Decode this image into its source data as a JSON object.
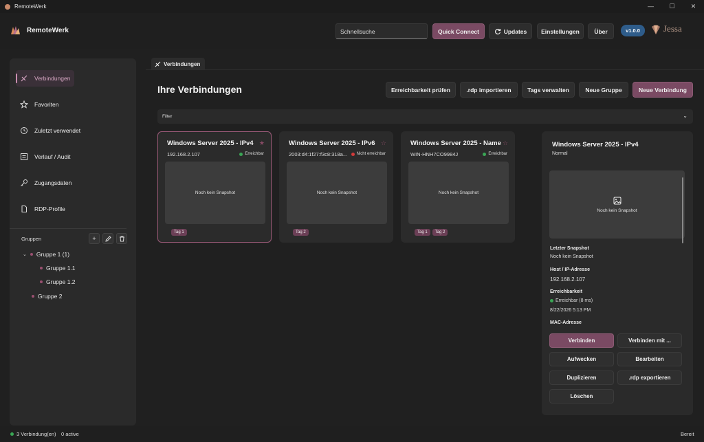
{
  "window": {
    "title": "RemoteWerk",
    "min": "—",
    "max": "☐",
    "close": "✕"
  },
  "header": {
    "app_name": "RemoteWerk",
    "search_value": "Schnellsuche",
    "quick_connect": "Quick Connect",
    "updates": "Updates",
    "settings": "Einstellungen",
    "about": "Über",
    "version": "v1.0.0",
    "brand": "Jessa"
  },
  "sidebar": {
    "items": [
      {
        "label": "Verbindungen",
        "icon": "plug-icon"
      },
      {
        "label": "Favoriten",
        "icon": "star-icon"
      },
      {
        "label": "Zuletzt verwendet",
        "icon": "history-icon"
      },
      {
        "label": "Verlauf / Audit",
        "icon": "list-icon"
      },
      {
        "label": "Zugangsdaten",
        "icon": "key-icon"
      },
      {
        "label": "RDP-Profile",
        "icon": "document-icon"
      }
    ],
    "groups_label": "Gruppen",
    "groups": [
      {
        "label": "Gruppe 1 (1)"
      },
      {
        "label": "Gruppe 1.1"
      },
      {
        "label": "Gruppe 1.2"
      },
      {
        "label": "Gruppe 2"
      }
    ]
  },
  "tab": {
    "label": "Verbindungen"
  },
  "main": {
    "title": "Ihre Verbindungen",
    "actions": {
      "check": "Erreichbarkeit prüfen",
      "import": ".rdp importieren",
      "tags": "Tags verwalten",
      "new_group": "Neue Gruppe",
      "new_connection": "Neue Verbindung"
    },
    "filter_label": "Filter",
    "cards": [
      {
        "name": "Windows Server 2025 - IPv4",
        "address": "192.168.2.107",
        "status": "Erreichbar",
        "snapshot": "Noch kein Snapshot",
        "tags": [
          "Tag 1"
        ]
      },
      {
        "name": "Windows Server 2025 - IPv6",
        "address": "2003:d4:1f27:f3c8:318a...",
        "status": "Nicht erreichbar",
        "snapshot": "Noch kein Snapshot",
        "tags": [
          "Tag 2"
        ]
      },
      {
        "name": "Windows Server 2025 - Name",
        "address": "WIN-HNH7CO9984J",
        "status": "Erreichbar",
        "snapshot": "Noch kein Snapshot",
        "tags": [
          "Tag 1",
          "Tag 2"
        ]
      }
    ]
  },
  "details": {
    "title": "Windows Server 2025 - IPv4",
    "subtitle": "Normal",
    "snapshot_text": "Noch kein Snapshot",
    "last_snapshot_label": "Letzter Snapshot",
    "last_snapshot_value": "Noch kein Snapshot",
    "host_label": "Host / IP-Adresse",
    "host_value": "192.168.2.107",
    "reach_label": "Erreichbarkeit",
    "reach_value": "Erreichbar  (8 ms)",
    "reach_time": "8/22/2026 5:13 PM",
    "mac_label": "MAC-Adresse",
    "buttons": {
      "connect": "Verbinden",
      "connect_with": "Verbinden mit ...",
      "wake": "Aufwecken",
      "edit": "Bearbeiten",
      "duplicate": "Duplizieren",
      "export": ".rdp exportieren",
      "delete": "Löschen"
    }
  },
  "status": {
    "connections": "3 Verbindung(en)",
    "active": "0 active",
    "ready": "Bereit"
  },
  "colors": {
    "accent": "#7a4a63",
    "ok": "#3aa655",
    "error": "#d23a3a",
    "version": "#2e5c8a"
  }
}
